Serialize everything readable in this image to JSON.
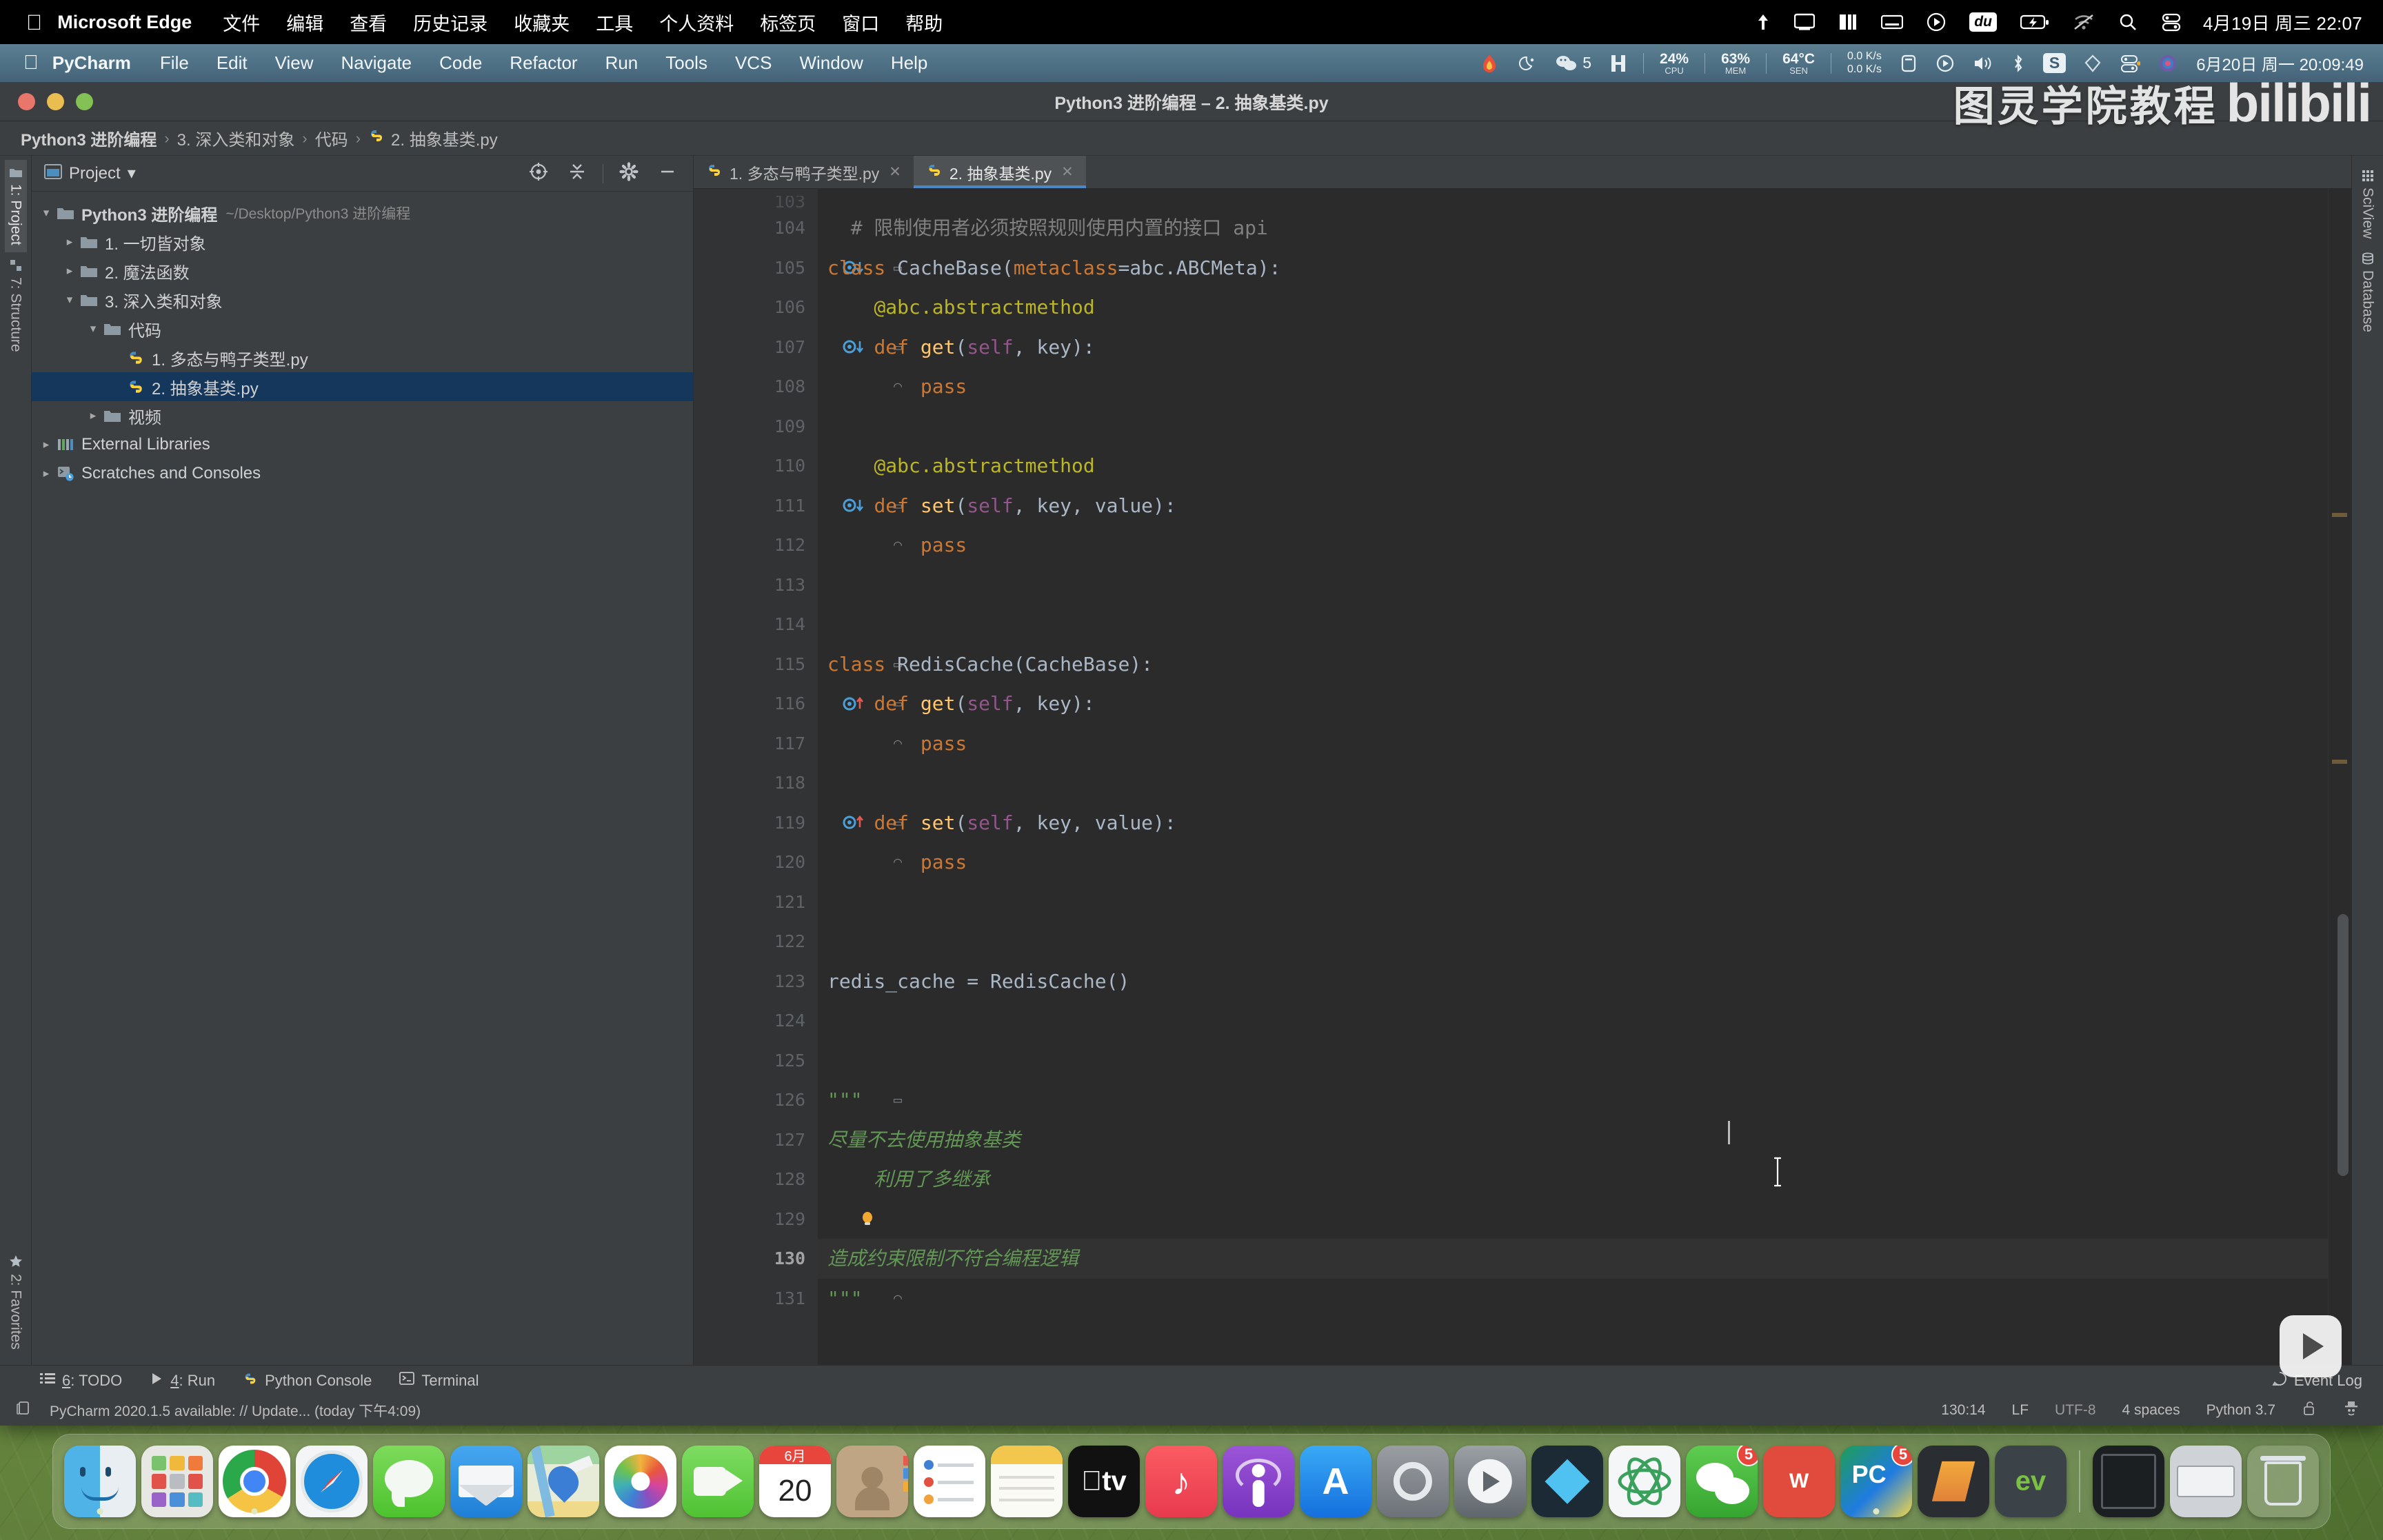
{
  "mac_menubar": {
    "apple": "",
    "app_name": "Microsoft Edge",
    "menus": [
      "文件",
      "编辑",
      "查看",
      "历史记录",
      "收藏夹",
      "工具",
      "个人资料",
      "标签页",
      "窗口",
      "帮助"
    ],
    "status_icons": [
      "upload-icon",
      "display-icon",
      "grid-icon",
      "keyboard-icon",
      "play-icon",
      "du-icon",
      "battery-charging-icon",
      "wifi-off-icon",
      "search-icon",
      "control-center-icon"
    ],
    "clock": "4月19日 周三  22:07"
  },
  "pycharm_menubar": {
    "app_name": "PyCharm",
    "menus": [
      "File",
      "Edit",
      "View",
      "Navigate",
      "Code",
      "Refactor",
      "Run",
      "Tools",
      "VCS",
      "Window",
      "Help"
    ],
    "stats": {
      "cpu_value": "24%",
      "cpu_label": "CPU",
      "mem_value": "63%",
      "mem_label": "MEM",
      "sen_value": "64°C",
      "sen_label": "SEN",
      "net_up": "0.0 K/s",
      "net_down": "0.0 K/s"
    },
    "wechat_badge": "5",
    "status_icons": [
      "flame-icon",
      "moon-icon",
      "wechat-icon",
      "shortcut-icon",
      "window-icon",
      "record-icon",
      "volume-icon",
      "bluetooth-icon",
      "s-app-icon",
      "gem-icon",
      "control-center-icon",
      "siri-icon"
    ],
    "clock": "6月20日 周一  20:09:49"
  },
  "window": {
    "title": "Python3 进阶编程 – 2. 抽象基类.py"
  },
  "breadcrumb": {
    "items": [
      "Python3 进阶编程",
      "3. 深入类和对象",
      "代码",
      "2. 抽象基类.py"
    ],
    "separator": "›"
  },
  "left_strip": {
    "tabs": [
      {
        "label": "1: Project",
        "icon": "folder-icon",
        "active": true
      },
      {
        "label": "7: Structure",
        "icon": "structure-icon",
        "active": false
      },
      {
        "label": "2: Favorites",
        "icon": "star-icon",
        "active": false
      }
    ]
  },
  "right_strip": {
    "tabs": [
      {
        "label": "SciView",
        "icon": "grid-icon"
      },
      {
        "label": "Database",
        "icon": "database-icon"
      }
    ]
  },
  "project_panel": {
    "title": "Project",
    "chevron": "▾",
    "toolbar_icons": [
      "locate-target-icon",
      "collapse-all-icon",
      "settings-gear-icon",
      "hide-panel-icon"
    ],
    "tree": [
      {
        "depth": 0,
        "arrow": "▾",
        "icon": "folder-icon",
        "label": "Python3 进阶编程",
        "bold": true,
        "path": "~/Desktop/Python3 进阶编程",
        "selected": false
      },
      {
        "depth": 1,
        "arrow": "▸",
        "icon": "folder-icon",
        "label": "1. 一切皆对象",
        "bold": false,
        "path": "",
        "selected": false
      },
      {
        "depth": 1,
        "arrow": "▸",
        "icon": "folder-icon",
        "label": "2. 魔法函数",
        "bold": false,
        "path": "",
        "selected": false
      },
      {
        "depth": 1,
        "arrow": "▾",
        "icon": "folder-icon",
        "label": "3. 深入类和对象",
        "bold": false,
        "path": "",
        "selected": false
      },
      {
        "depth": 2,
        "arrow": "▾",
        "icon": "folder-icon",
        "label": "代码",
        "bold": false,
        "path": "",
        "selected": false
      },
      {
        "depth": 3,
        "arrow": "",
        "icon": "python-file-icon",
        "label": "1. 多态与鸭子类型.py",
        "bold": false,
        "path": "",
        "selected": false
      },
      {
        "depth": 3,
        "arrow": "",
        "icon": "python-file-icon",
        "label": "2. 抽象基类.py",
        "bold": false,
        "path": "",
        "selected": true
      },
      {
        "depth": 2,
        "arrow": "▸",
        "icon": "folder-icon",
        "label": "视频",
        "bold": false,
        "path": "",
        "selected": false
      },
      {
        "depth": 0,
        "arrow": "▸",
        "icon": "library-icon",
        "label": "External Libraries",
        "bold": false,
        "path": "",
        "selected": false
      },
      {
        "depth": 0,
        "arrow": "▸",
        "icon": "scratches-icon",
        "label": "Scratches and Consoles",
        "bold": false,
        "path": "",
        "selected": false
      }
    ]
  },
  "editor_tabs": [
    {
      "label": "1. 多态与鸭子类型.py",
      "icon": "python-file-icon",
      "active": false,
      "close": "✕"
    },
    {
      "label": "2. 抽象基类.py",
      "icon": "python-file-icon",
      "active": true,
      "close": "✕"
    }
  ],
  "editor": {
    "first_line": 103,
    "partial_top_line": "103",
    "lines": [
      {
        "n": 104,
        "gutter": "",
        "fold": "",
        "current": false,
        "tokens": [
          {
            "t": "cm",
            "v": "# 限制使用者必须按照规则使用内置的接口 api"
          }
        ],
        "indent": 2
      },
      {
        "n": 105,
        "gutter": "run-down",
        "fold": "▭",
        "current": false,
        "tokens": [
          {
            "t": "k",
            "v": "class "
          },
          {
            "t": "cls",
            "v": "CacheBase"
          },
          {
            "t": "pl",
            "v": "("
          },
          {
            "t": "kw2",
            "v": "metaclass"
          },
          {
            "t": "pl",
            "v": "=abc.ABCMeta):"
          }
        ],
        "indent": 0
      },
      {
        "n": 106,
        "gutter": "",
        "fold": "",
        "current": false,
        "tokens": [
          {
            "t": "deco",
            "v": "@abc.abstractmethod"
          }
        ],
        "indent": 4
      },
      {
        "n": 107,
        "gutter": "run-down",
        "fold": "▭",
        "current": false,
        "tokens": [
          {
            "t": "k",
            "v": "def "
          },
          {
            "t": "fn",
            "v": "get"
          },
          {
            "t": "pl",
            "v": "("
          },
          {
            "t": "self",
            "v": "self"
          },
          {
            "t": "pl",
            "v": ", key):"
          }
        ],
        "indent": 4
      },
      {
        "n": 108,
        "gutter": "",
        "fold": "◠",
        "current": false,
        "tokens": [
          {
            "t": "k",
            "v": "pass"
          }
        ],
        "indent": 8
      },
      {
        "n": 109,
        "gutter": "",
        "fold": "",
        "current": false,
        "tokens": [],
        "indent": 0
      },
      {
        "n": 110,
        "gutter": "",
        "fold": "",
        "current": false,
        "tokens": [
          {
            "t": "deco",
            "v": "@abc.abstractmethod"
          }
        ],
        "indent": 4
      },
      {
        "n": 111,
        "gutter": "run-down",
        "fold": "▭",
        "current": false,
        "tokens": [
          {
            "t": "k",
            "v": "def "
          },
          {
            "t": "fn",
            "v": "set"
          },
          {
            "t": "pl",
            "v": "("
          },
          {
            "t": "self",
            "v": "self"
          },
          {
            "t": "pl",
            "v": ", key, value):"
          }
        ],
        "indent": 4
      },
      {
        "n": 112,
        "gutter": "",
        "fold": "◠",
        "current": false,
        "tokens": [
          {
            "t": "k",
            "v": "pass"
          }
        ],
        "indent": 8
      },
      {
        "n": 113,
        "gutter": "",
        "fold": "",
        "current": false,
        "tokens": [],
        "indent": 0
      },
      {
        "n": 114,
        "gutter": "",
        "fold": "",
        "current": false,
        "tokens": [],
        "indent": 0
      },
      {
        "n": 115,
        "gutter": "",
        "fold": "▭",
        "current": false,
        "tokens": [
          {
            "t": "k",
            "v": "class "
          },
          {
            "t": "cls",
            "v": "RedisCache"
          },
          {
            "t": "pl",
            "v": "(CacheBase):"
          }
        ],
        "indent": 0
      },
      {
        "n": 116,
        "gutter": "run-up",
        "fold": "▭",
        "current": false,
        "tokens": [
          {
            "t": "k",
            "v": "def "
          },
          {
            "t": "fn",
            "v": "get"
          },
          {
            "t": "pl",
            "v": "("
          },
          {
            "t": "self",
            "v": "self"
          },
          {
            "t": "pl",
            "v": ", key):"
          }
        ],
        "indent": 4
      },
      {
        "n": 117,
        "gutter": "",
        "fold": "◠",
        "current": false,
        "tokens": [
          {
            "t": "k",
            "v": "pass"
          }
        ],
        "indent": 8
      },
      {
        "n": 118,
        "gutter": "",
        "fold": "",
        "current": false,
        "tokens": [],
        "indent": 0
      },
      {
        "n": 119,
        "gutter": "run-up",
        "fold": "▭",
        "current": false,
        "tokens": [
          {
            "t": "k",
            "v": "def "
          },
          {
            "t": "fn",
            "v": "set"
          },
          {
            "t": "pl",
            "v": "("
          },
          {
            "t": "self",
            "v": "self"
          },
          {
            "t": "pl",
            "v": ", key, value):"
          }
        ],
        "indent": 4
      },
      {
        "n": 120,
        "gutter": "",
        "fold": "◠",
        "current": false,
        "tokens": [
          {
            "t": "k",
            "v": "pass"
          }
        ],
        "indent": 8
      },
      {
        "n": 121,
        "gutter": "",
        "fold": "",
        "current": false,
        "tokens": [],
        "indent": 0
      },
      {
        "n": 122,
        "gutter": "",
        "fold": "",
        "current": false,
        "tokens": [],
        "indent": 0
      },
      {
        "n": 123,
        "gutter": "",
        "fold": "",
        "current": false,
        "tokens": [
          {
            "t": "pl",
            "v": "redis_cache = RedisCache()"
          }
        ],
        "indent": 0
      },
      {
        "n": 124,
        "gutter": "",
        "fold": "",
        "current": false,
        "tokens": [],
        "indent": 0
      },
      {
        "n": 125,
        "gutter": "",
        "fold": "",
        "current": false,
        "tokens": [],
        "indent": 0
      },
      {
        "n": 126,
        "gutter": "",
        "fold": "▭",
        "current": false,
        "tokens": [
          {
            "t": "str",
            "v": "\"\"\""
          }
        ],
        "indent": 0
      },
      {
        "n": 127,
        "gutter": "",
        "fold": "",
        "current": false,
        "tokens": [
          {
            "t": "str",
            "v": "尽量不去使用抽象基类"
          }
        ],
        "indent": 0
      },
      {
        "n": 128,
        "gutter": "",
        "fold": "",
        "current": false,
        "tokens": [
          {
            "t": "str",
            "v": "    利用了多继承"
          }
        ],
        "indent": 0
      },
      {
        "n": 129,
        "gutter": "bulb",
        "fold": "",
        "current": false,
        "tokens": [],
        "indent": 0
      },
      {
        "n": 130,
        "gutter": "",
        "fold": "",
        "current": true,
        "tokens": [
          {
            "t": "str",
            "v": "造成约束限制不符合编程逻辑"
          }
        ],
        "indent": 0
      },
      {
        "n": 131,
        "gutter": "",
        "fold": "◠",
        "current": false,
        "tokens": [
          {
            "t": "str",
            "v": "\"\"\""
          }
        ],
        "indent": 0
      }
    ]
  },
  "toolwindow_bar": {
    "items": [
      {
        "label": "6: TODO",
        "num": "6",
        "rest": ": TODO",
        "icon": "todo-list-icon"
      },
      {
        "label": "4: Run",
        "num": "4",
        "rest": ": Run",
        "icon": "run-play-icon"
      },
      {
        "label": "Python Console",
        "num": "",
        "rest": "Python Console",
        "icon": "python-icon"
      },
      {
        "label": "Terminal",
        "num": "",
        "rest": "Terminal",
        "icon": "terminal-icon"
      }
    ],
    "event_log": "Event Log"
  },
  "statusbar": {
    "message": "PyCharm 2020.1.5 available: // Update... (today 下午4:09)",
    "left_icon": "notification-icon",
    "caret_position": "130:14",
    "line_separator": "LF",
    "encoding": "UTF-8",
    "indent": "4 spaces",
    "interpreter": "Python 3.7",
    "right_icons": [
      "lock-open-icon",
      "inspector-hat-icon"
    ]
  },
  "watermark": {
    "text": "图灵学院教程",
    "logo": "bilibili"
  },
  "dock": {
    "items": [
      {
        "name": "finder",
        "label": "Finder",
        "running": true
      },
      {
        "name": "launchpad",
        "label": "Launchpad",
        "running": false
      },
      {
        "name": "chrome",
        "label": "Google Chrome",
        "running": true
      },
      {
        "name": "safari",
        "label": "Safari",
        "running": false
      },
      {
        "name": "messages",
        "label": "Messages",
        "running": false
      },
      {
        "name": "mail",
        "label": "Mail",
        "running": false
      },
      {
        "name": "maps",
        "label": "Maps",
        "running": false
      },
      {
        "name": "photos",
        "label": "Photos",
        "running": false
      },
      {
        "name": "facetime",
        "label": "FaceTime",
        "running": false
      },
      {
        "name": "calendar",
        "label": "Calendar",
        "running": false,
        "cal_month": "6月",
        "cal_day": "20"
      },
      {
        "name": "contacts",
        "label": "Contacts",
        "running": false
      },
      {
        "name": "reminders",
        "label": "Reminders",
        "running": false
      },
      {
        "name": "notes",
        "label": "Notes",
        "running": false
      },
      {
        "name": "appletv",
        "label": "Apple TV",
        "running": false
      },
      {
        "name": "music",
        "label": "Music",
        "running": false
      },
      {
        "name": "podcasts",
        "label": "Podcasts",
        "running": false
      },
      {
        "name": "appstore",
        "label": "App Store",
        "running": false
      },
      {
        "name": "settings",
        "label": "System Preferences",
        "running": false
      },
      {
        "name": "quicktime",
        "label": "QuickTime Player",
        "running": false
      },
      {
        "name": "shadowsocks",
        "label": "ShadowsocksX",
        "running": false
      },
      {
        "name": "atom",
        "label": "Atom",
        "running": false
      },
      {
        "name": "wechat",
        "label": "WeChat",
        "running": false,
        "badge": "5"
      },
      {
        "name": "wps",
        "label": "WPS",
        "running": false
      },
      {
        "name": "pycharm",
        "label": "PyCharm",
        "running": true,
        "badge": "5"
      },
      {
        "name": "sublime",
        "label": "Sublime Text",
        "running": false
      },
      {
        "name": "evernote",
        "label": "Evernote",
        "running": false
      },
      {
        "name": "screen",
        "label": "Screen",
        "running": false
      },
      {
        "name": "downloads",
        "label": "Downloads",
        "running": false
      },
      {
        "name": "trash",
        "label": "Trash",
        "running": false
      }
    ]
  }
}
